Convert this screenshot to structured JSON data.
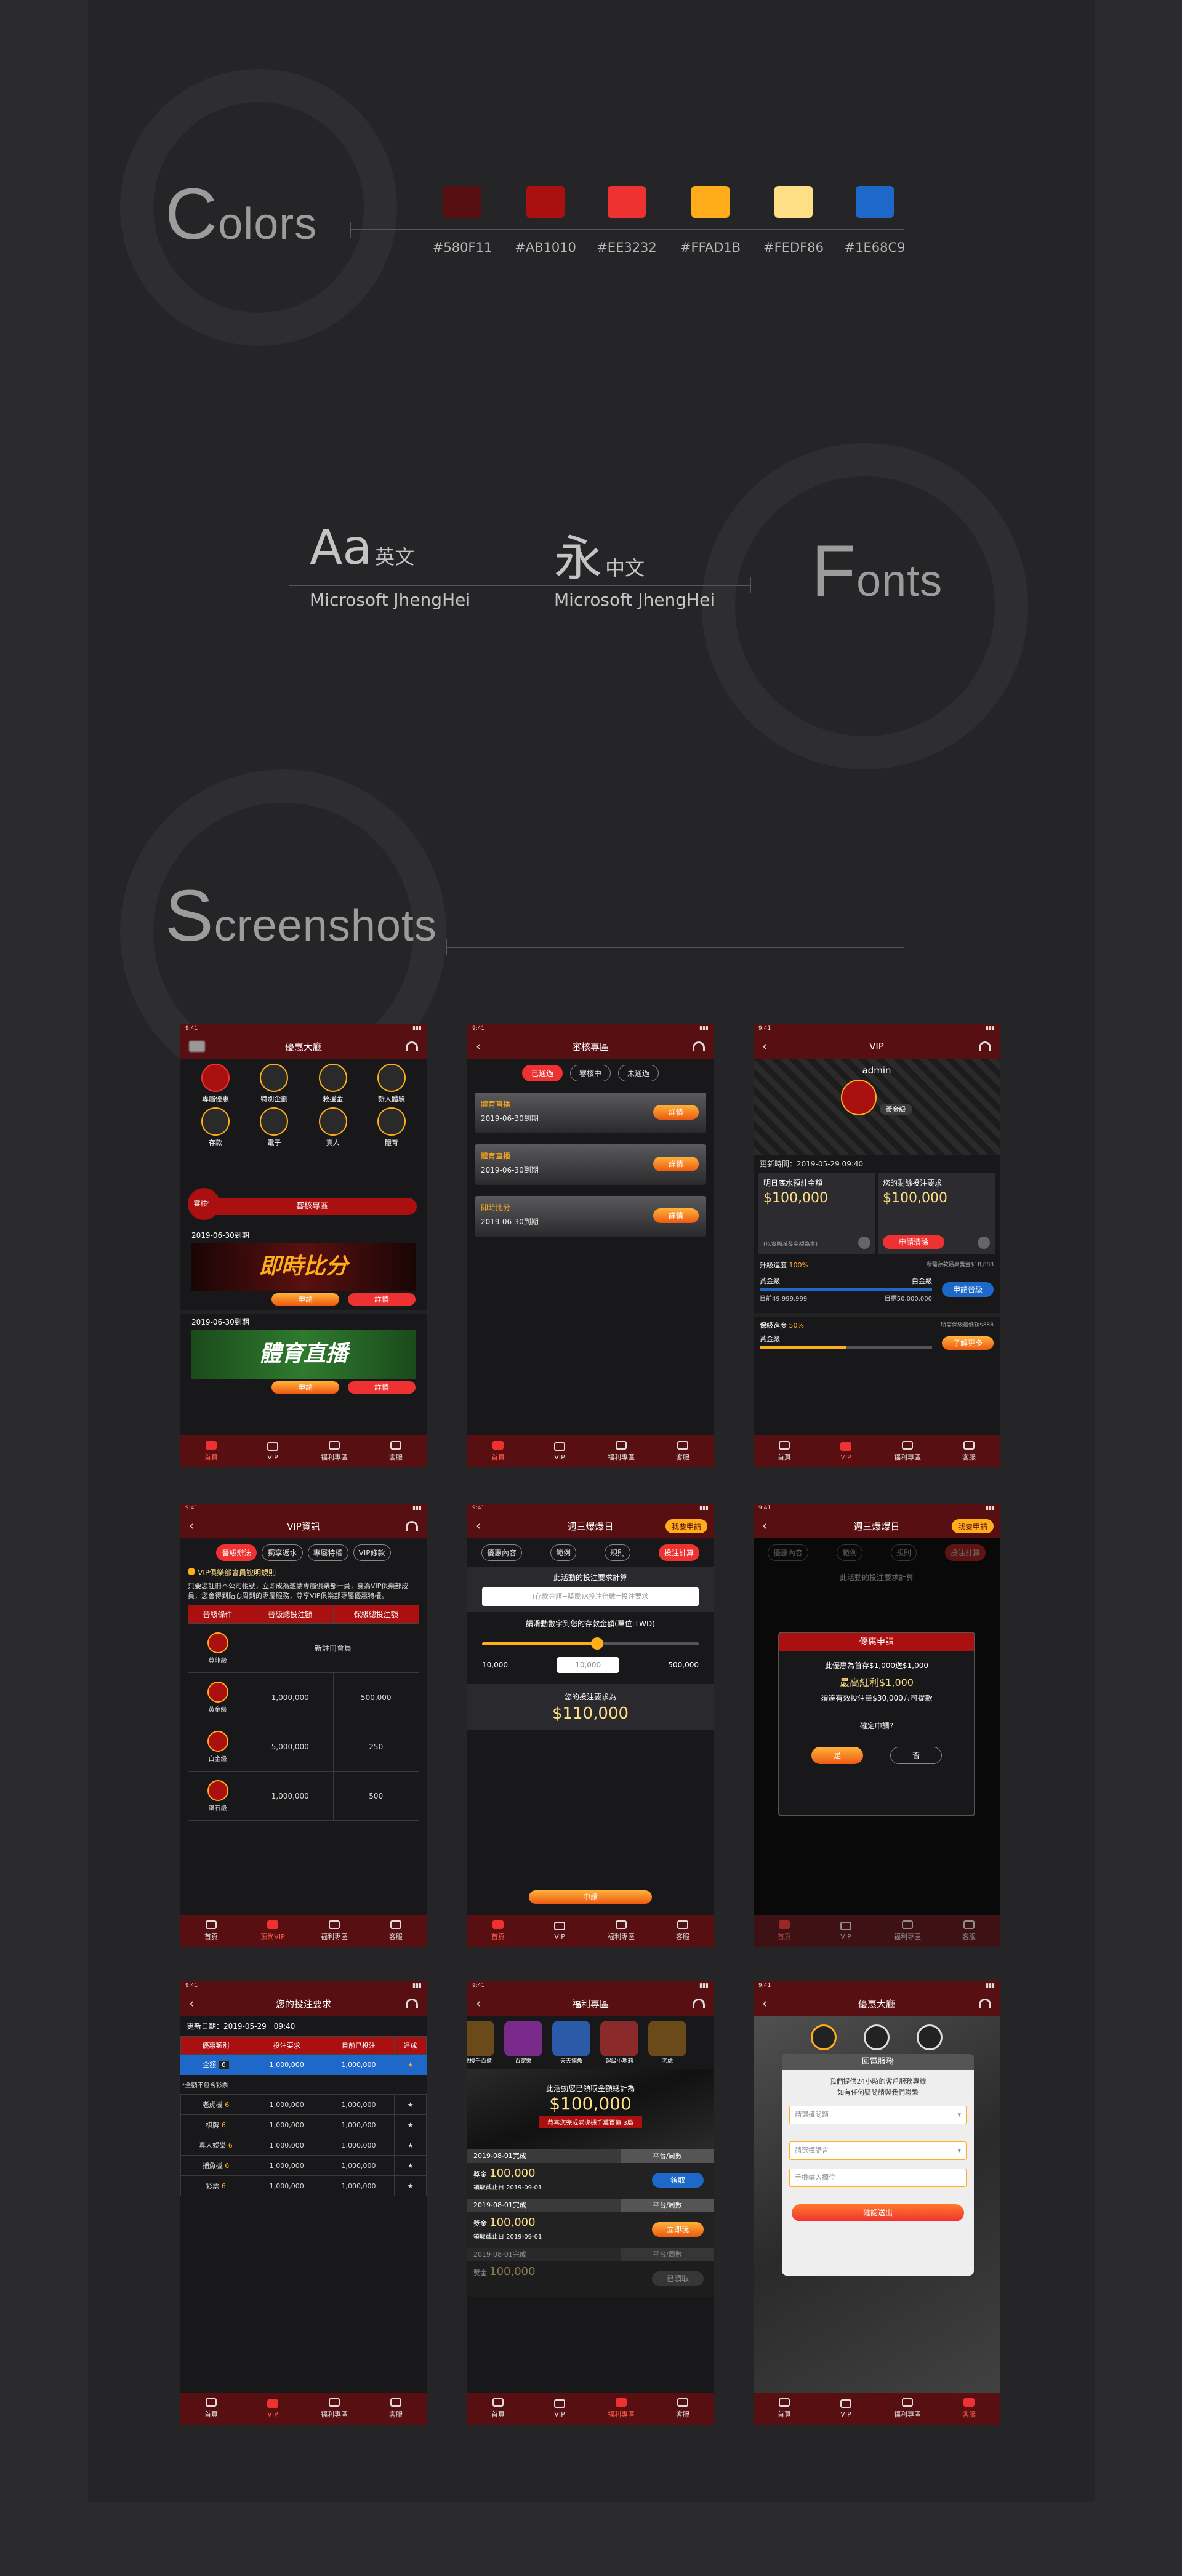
{
  "sections": {
    "colors": {
      "first_letter": "C",
      "rest": "olors"
    },
    "fonts": {
      "first_letter": "F",
      "rest": "onts"
    },
    "screenshots": {
      "first_letter": "S",
      "rest": "creenshots"
    }
  },
  "palette": [
    {
      "hex": "#580F11",
      "label": "#580F11"
    },
    {
      "hex": "#AB1010",
      "label": "#AB1010"
    },
    {
      "hex": "#EE3232",
      "label": "#EE3232"
    },
    {
      "hex": "#FFAD1B",
      "label": "#FFAD1B"
    },
    {
      "hex": "#FEDF86",
      "label": "#FEDF86"
    },
    {
      "hex": "#1E68C9",
      "label": "#1E68C9"
    }
  ],
  "font_samples": [
    {
      "glyph": "Aa",
      "lang": "英文",
      "name": "Microsoft JhengHei"
    },
    {
      "glyph": "永",
      "lang": "中文",
      "name": "Microsoft JhengHei"
    }
  ],
  "status_time": "9:41",
  "tabbar": {
    "home": "首頁",
    "vip": "VIP",
    "welfare": "福利專區",
    "service": "客服",
    "vip2": "頂尚VIP"
  },
  "s1": {
    "title": "優惠大廳",
    "icons": [
      "專屬優惠",
      "特別企劃",
      "救援金",
      "新人體驗",
      "存款",
      "電子",
      "真人",
      "體育"
    ],
    "pending_badge": "審核中",
    "review_button": "審核專區",
    "date1": "2019-06-30到期",
    "banner1": "即時比分",
    "date2": "2019-06-30到期",
    "banner2": "體育直播",
    "apply": "申請",
    "detail": "詳情"
  },
  "s2": {
    "title": "審核專區",
    "tabs": [
      "已通過",
      "審核中",
      "未通過"
    ],
    "cards": [
      {
        "name": "體育直播",
        "date": "2019-06-30到期",
        "btn": "詳情"
      },
      {
        "name": "體育直播",
        "date": "2019-06-30到期",
        "btn": "詳情"
      },
      {
        "name": "即時比分",
        "date": "2019-06-30到期",
        "btn": "詳情"
      }
    ]
  },
  "s3": {
    "title": "VIP",
    "user": "admin",
    "level_badge": "黃金級",
    "update": "更新時間：2019-05-29 09:40",
    "left_label": "明日底水預計金額",
    "left_value": "$100,000",
    "right_label": "您的剩餘投注要求",
    "right_value": "$100,000",
    "left_note": "(以實際派發金額為主)",
    "right_btn": "申請清除",
    "upgrade_label": "升級進度",
    "upgrade_pct": "100%",
    "upgrade_note": "所需存款最高獎金$18,888",
    "lv_from": "黃金級",
    "lv_to": "白金級",
    "current": "目前49,999,999",
    "target": "目標50,000,000",
    "apply_upgrade": "申請晉級",
    "keep_label": "保級進度",
    "keep_pct": "50%",
    "keep_note": "所需保級最低額$888",
    "keep_level": "黃金級",
    "more": "了解更多",
    "upgrade_fill": 1.0,
    "keep_fill": 0.5
  },
  "s4": {
    "title": "VIP資訊",
    "tabs": [
      "晉級辦法",
      "獨享返水",
      "專屬特權",
      "VIP條款"
    ],
    "heading": "VIP俱樂部會員說明規則",
    "para": "只要您註冊本公司帳號，立即成為邀請專屬俱樂部一員，身為VIP俱樂部成員，您會得到貼心周到的專屬服務，尊享VIP俱樂部專屬優惠特權。",
    "headers": [
      "晉級條件",
      "晉級總投注額",
      "保級總投注額"
    ],
    "rows": [
      {
        "level": "尊龍級",
        "a": "新註冊會員",
        "b": ""
      },
      {
        "level": "黃金級",
        "a": "1,000,000",
        "b": "500,000"
      },
      {
        "level": "白金級",
        "a": "5,000,000",
        "b": "250"
      },
      {
        "level": "鑽石級",
        "a": "1,000,000",
        "b": "500"
      }
    ]
  },
  "s5": {
    "title": "週三爆爆日",
    "pill": "我要申請",
    "tabs": [
      "優惠內容",
      "範例",
      "規則",
      "投注計算"
    ],
    "calc_title": "此活動的投注要求計算",
    "formula": "(存款金額+獎勵)X投注倍數=投注要求",
    "slider_label": "請滑動數字到您的存款金額(單位:TWD)",
    "min": "10,000",
    "input_val": "10,000",
    "max": "500,000",
    "result_label": "您的投注要求為",
    "result": "$110,000",
    "apply": "申請",
    "slider_value": 0.53
  },
  "s6": {
    "dialog_title": "優惠申請",
    "line1": "此優惠為首存$1,000送$1,000",
    "line2": "最高紅利$1,000",
    "line3": "須達有效投注量$30,000方可提款",
    "confirm": "確定申請?",
    "yes": "是",
    "no": "否"
  },
  "s7": {
    "title": "您的投注要求",
    "update": "更新日期：2019-05-29　09:40",
    "headers": [
      "優惠類別",
      "投注要求",
      "目前已投注",
      "達成"
    ],
    "total": {
      "name": "全額",
      "n": "6",
      "a": "1,000,000",
      "b": "1,000,000"
    },
    "note": "*全額不包含彩票",
    "rows": [
      {
        "name": "老虎機",
        "n": "6",
        "a": "1,000,000",
        "b": "1,000,000"
      },
      {
        "name": "棋牌",
        "n": "6",
        "a": "1,000,000",
        "b": "1,000,000"
      },
      {
        "name": "真人娛樂",
        "n": "6",
        "a": "1,000,000",
        "b": "1,000,000"
      },
      {
        "name": "捕魚機",
        "n": "6",
        "a": "1,000,000",
        "b": "1,000,000"
      },
      {
        "name": "彩票",
        "n": "6",
        "a": "1,000,000",
        "b": "1,000,000"
      }
    ]
  },
  "s8": {
    "title": "福利專區",
    "games": [
      "老虎機千百億",
      "百家樂",
      "天天捕魚",
      "超級小瑪莉",
      "老虎"
    ],
    "total_label": "此活動您已領取金額總計為",
    "total": "$100,000",
    "notice": "恭喜您完成老虎機千萬百億 3局",
    "items": [
      {
        "date": "2019-08-01完成",
        "type": "平台/周數",
        "label": "獎金",
        "amount": "100,000",
        "deadline": "領取截止日 2019-09-01",
        "btn": "領取"
      },
      {
        "date": "2019-08-01完成",
        "type": "平台/周數",
        "label": "獎金",
        "amount": "100,000",
        "deadline": "領取截止日 2019-09-01",
        "btn": "立即玩"
      },
      {
        "date": "2019-08-01完成",
        "type": "平台/周數",
        "label": "獎金",
        "amount": "100,000",
        "deadline": "",
        "btn": "已領取"
      }
    ]
  },
  "s9": {
    "title": "優惠大廳",
    "dialog_title": "回電服務",
    "desc1": "我們提供24小時的客戶服務專線",
    "desc2": "如有任何疑問請與我們聯繫",
    "select1": "請選擇問題",
    "select2": "請選擇語言",
    "phone_placeholder": "手機輸入欄位",
    "submit": "確認送出"
  }
}
